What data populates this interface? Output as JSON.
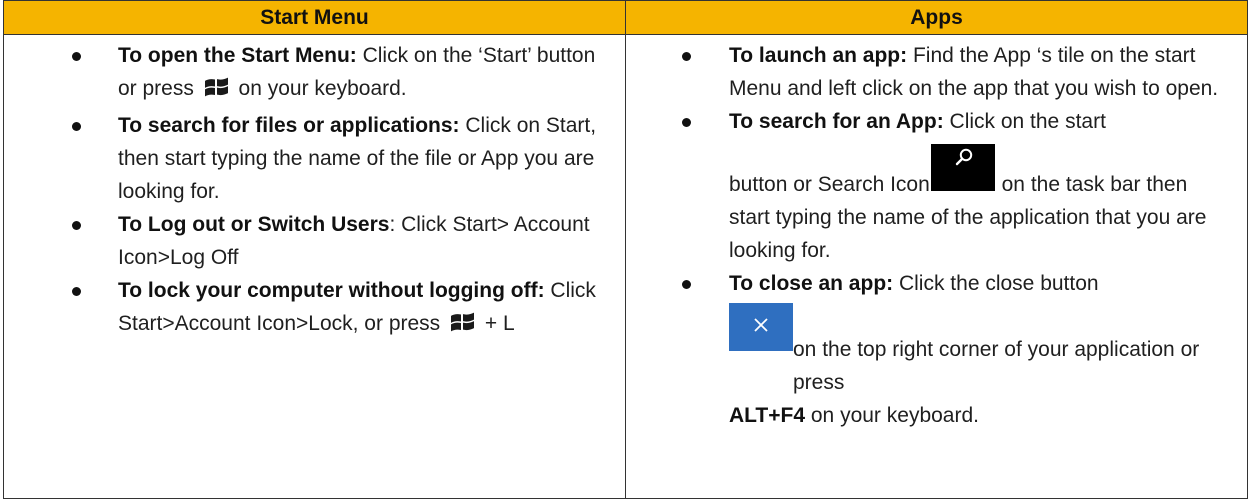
{
  "headers": {
    "left": "Start Menu",
    "right": "Apps"
  },
  "left_items": [
    {
      "bold": "To open the Start Menu:",
      "text_before_icon": " Click on the ‘Start’ button or press",
      "icon": "windows-logo-icon",
      "text_after_icon": " on your keyboard."
    },
    {
      "bold": "To search for files or applications:",
      "text": " Click on Start, then start typing the name of the file or App you are looking for."
    },
    {
      "bold": "To Log out or Switch Users",
      "text": ": Click Start> Account Icon>Log Off"
    },
    {
      "bold": "To lock your computer without logging off:",
      "text_before_icon": " Click Start>Account Icon>Lock,  or press",
      "icon": "windows-logo-icon",
      "text_after_icon": " + L"
    }
  ],
  "right_items": [
    {
      "bold": "To launch an app:",
      "text": " Find the App ‘s tile on the start Menu and left click on the app that you wish to open."
    },
    {
      "bold": "To search for an App:",
      "text_first_line": " Click on the start",
      "text_before_icon": "button or Search Icon",
      "icon": "search-icon",
      "text_after_icon": " on the task bar then start typing the name of the application that you are looking for."
    },
    {
      "bold": "To close an app:",
      "text_before_icon": " Click the close button",
      "icon": "close-icon",
      "text_after_icon": "on the top right corner of your application or press ",
      "bold_key": "ALT+F4",
      "text_end": " on your keyboard."
    }
  ],
  "colors": {
    "header_bg": "#f5b400",
    "close_tile": "#2f6fc0",
    "search_tile": "#000000"
  }
}
